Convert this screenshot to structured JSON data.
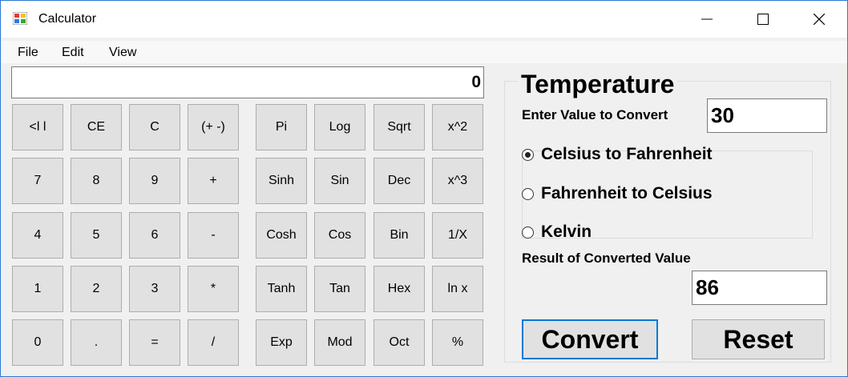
{
  "window": {
    "title": "Calculator"
  },
  "menu": [
    "File",
    "Edit",
    "View"
  ],
  "display": {
    "value": "0"
  },
  "keypad": [
    [
      "<l l",
      "CE",
      "C",
      "(+ -)",
      "Pi",
      "Log",
      "Sqrt",
      "x^2"
    ],
    [
      "7",
      "8",
      "9",
      "+",
      "Sinh",
      "Sin",
      "Dec",
      "x^3"
    ],
    [
      "4",
      "5",
      "6",
      "-",
      "Cosh",
      "Cos",
      "Bin",
      "1/X"
    ],
    [
      "1",
      "2",
      "3",
      "*",
      "Tanh",
      "Tan",
      "Hex",
      "ln x"
    ],
    [
      "0",
      ".",
      "=",
      "/",
      "Exp",
      "Mod",
      "Oct",
      "%"
    ]
  ],
  "temperature": {
    "title": "Temperature",
    "input_label": "Enter Value to Convert",
    "input_value": "30",
    "options": [
      {
        "label": "Celsius to Fahrenheit",
        "checked": true
      },
      {
        "label": "Fahrenheit to Celsius",
        "checked": false
      },
      {
        "label": "Kelvin",
        "checked": false
      }
    ],
    "result_label": "Result of Converted Value",
    "result_value": "86",
    "convert_label": "Convert",
    "reset_label": "Reset"
  },
  "icons": {
    "app": "app-icon",
    "minimize": "minimize-icon",
    "maximize": "maximize-icon",
    "close": "close-icon"
  }
}
